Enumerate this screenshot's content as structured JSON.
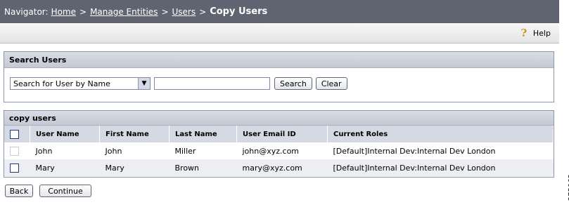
{
  "navigator": {
    "label": "Navigator:",
    "breadcrumbs": [
      "Home",
      "Manage Entities",
      "Users"
    ],
    "separator": ">",
    "current": "Copy Users"
  },
  "help": {
    "icon": "help-icon",
    "label": "Help"
  },
  "search": {
    "title": "Search Users",
    "select_value": "Search for User by Name",
    "input_value": "",
    "search_button": "Search",
    "clear_button": "Clear"
  },
  "users": {
    "title": "copy users",
    "columns": [
      "User Name",
      "First Name",
      "Last Name",
      "User Email ID",
      "Current Roles"
    ],
    "rows": [
      {
        "user_name": "John",
        "first_name": "John",
        "last_name": "Miller",
        "email": "john@xyz.com",
        "roles": "[Default]Internal Dev:Internal Dev London",
        "checkbox_enabled": false
      },
      {
        "user_name": "Mary",
        "first_name": "Mary",
        "last_name": "Brown",
        "email": "mary@xyz.com",
        "roles": "[Default]Internal Dev:Internal Dev London",
        "checkbox_enabled": true
      }
    ]
  },
  "buttons": {
    "back": "Back",
    "continue": "Continue"
  },
  "figure_id": "275063"
}
